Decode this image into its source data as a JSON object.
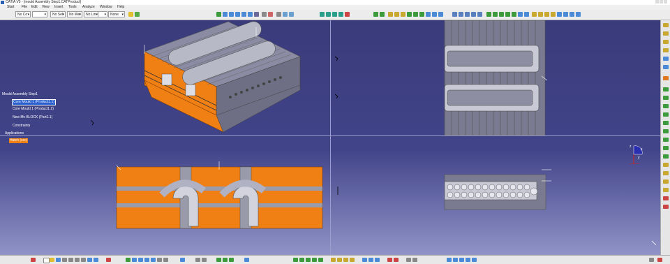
{
  "window": {
    "title": "CATIA V5 - [mould Assembly Step1.CATProduct]"
  },
  "menubar": {
    "items": [
      "Start",
      "File",
      "Edit",
      "View",
      "Insert",
      "Tools",
      "Analyze",
      "Window",
      "Help"
    ]
  },
  "toolbar": {
    "combos": [
      {
        "name": "layer",
        "value": "No Co",
        "arrow": "▾"
      },
      {
        "name": "color",
        "value": "",
        "arrow": "▾"
      },
      {
        "name": "linetype",
        "value": "No Sel",
        "arrow": "▾"
      },
      {
        "name": "weight",
        "value": "No Wei",
        "arrow": "▾"
      },
      {
        "name": "style",
        "value": "No Lin",
        "arrow": "▾"
      },
      {
        "name": "point",
        "value": "",
        "arrow": "▾"
      },
      {
        "name": "render",
        "value": "None",
        "arrow": "▾"
      }
    ]
  },
  "tree": {
    "root": "Mould Assembly Step1",
    "items": [
      "Core Mould 1 (Product1.1)",
      "Core Mould 1 (Product1.2)",
      "New Mv BLOCK (Part1.1)",
      "Constraints",
      "Applications"
    ],
    "footer": "Hatch (ccc)"
  },
  "compass": {
    "labels": [
      "x",
      "y",
      "z"
    ]
  },
  "colors": {
    "accent_orange": "#f07f14",
    "viewport_top": "#393b7b",
    "viewport_bottom": "#8f93c6",
    "tree_selected": "#2a5fd0"
  }
}
